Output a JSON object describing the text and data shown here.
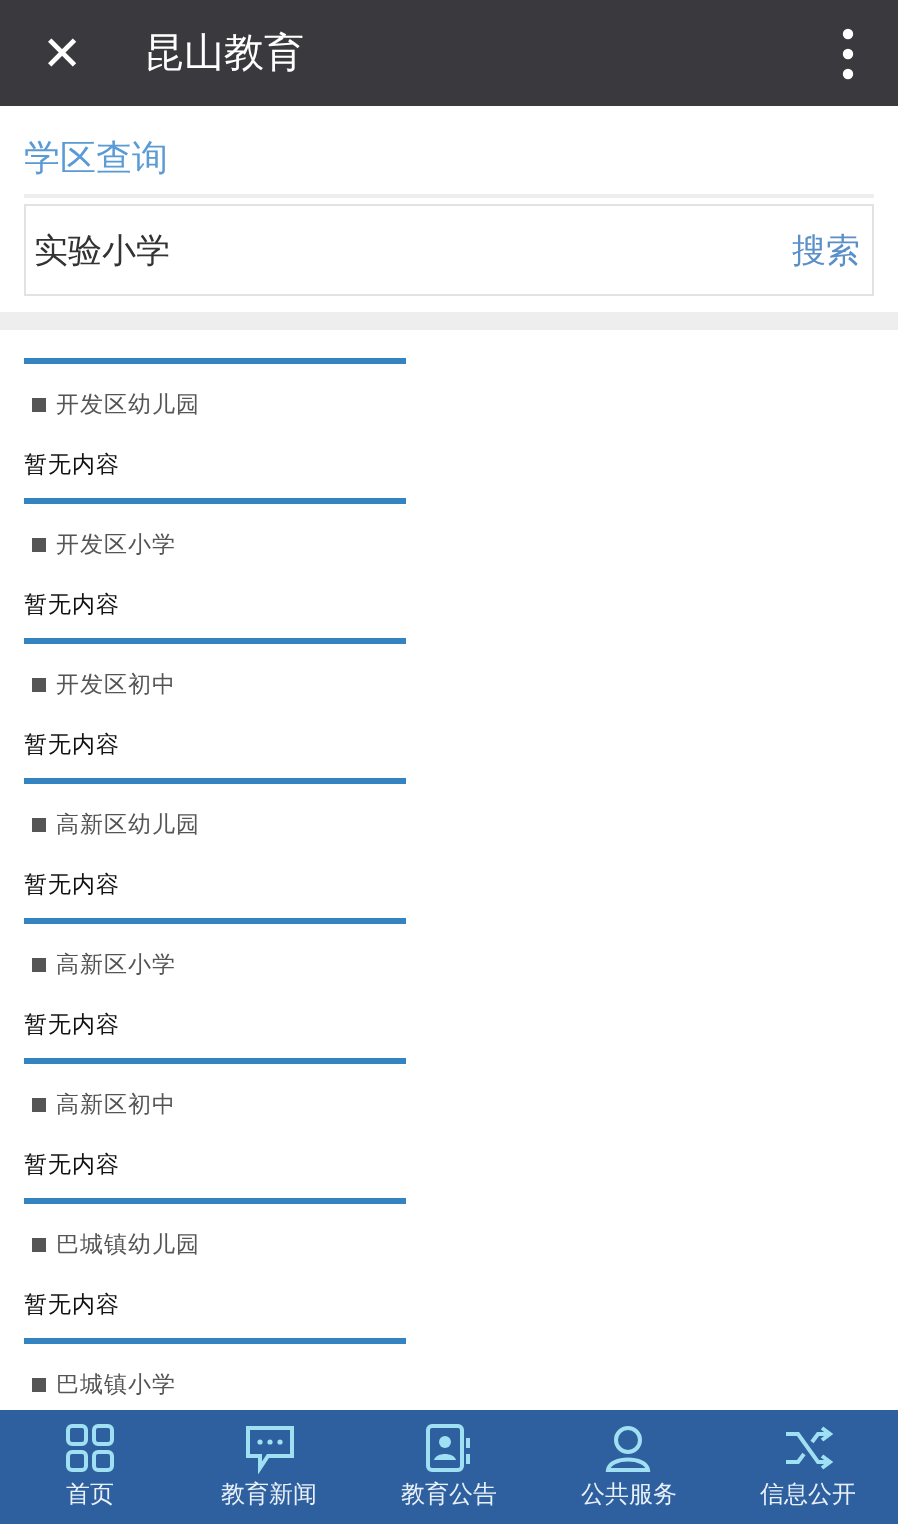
{
  "header": {
    "close_icon": "✕",
    "title": "昆山教育"
  },
  "page_title": "学区查询",
  "search": {
    "value": "实验小学",
    "button": "搜索"
  },
  "sections": [
    {
      "heading": "开发区幼儿园",
      "content": "暂无内容"
    },
    {
      "heading": "开发区小学",
      "content": "暂无内容"
    },
    {
      "heading": "开发区初中",
      "content": "暂无内容"
    },
    {
      "heading": "高新区幼儿园",
      "content": "暂无内容"
    },
    {
      "heading": "高新区小学",
      "content": "暂无内容"
    },
    {
      "heading": "高新区初中",
      "content": "暂无内容"
    },
    {
      "heading": "巴城镇幼儿园",
      "content": "暂无内容"
    },
    {
      "heading": "巴城镇小学"
    }
  ],
  "tabs": [
    {
      "kind": "grid",
      "label": "首页"
    },
    {
      "kind": "chat",
      "label": "教育新闻"
    },
    {
      "kind": "contact",
      "label": "教育公告"
    },
    {
      "kind": "person",
      "label": "公共服务"
    },
    {
      "kind": "shuffle",
      "label": "信息公开"
    }
  ]
}
